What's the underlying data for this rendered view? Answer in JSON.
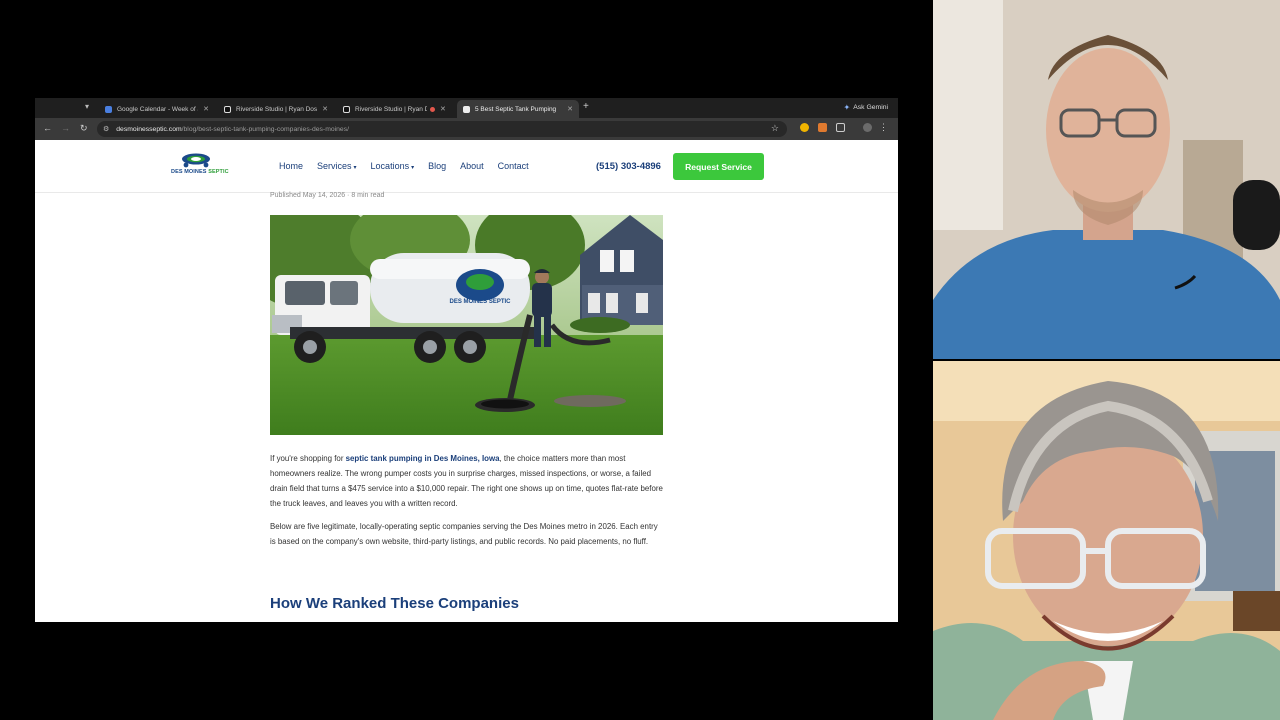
{
  "browser": {
    "tabs": [
      {
        "title": "Google Calendar - Week of J",
        "favicon_color": "#4a7fe0",
        "active": false
      },
      {
        "title": "Riverside Studio | Ryan Dosw",
        "favicon_color": "#dddddd",
        "active": false
      },
      {
        "title": "Riverside Studio | Ryan D",
        "favicon_color": "#dddddd",
        "active": false,
        "recording": true
      },
      {
        "title": "5 Best Septic Tank Pumping",
        "favicon_color": "#dddddd",
        "active": true
      }
    ],
    "new_tab_symbol": "+",
    "gemini_label": "Ask Gemini",
    "address": {
      "domain": "desmoinesseptic.com",
      "path": "/blog/best-septic-tank-pumping-companies-des-moines/"
    }
  },
  "site": {
    "logo": {
      "text_primary": "DES MOINES",
      "text_accent": "SEPTIC"
    },
    "nav": [
      {
        "label": "Home",
        "has_dropdown": false
      },
      {
        "label": "Services",
        "has_dropdown": true
      },
      {
        "label": "Locations",
        "has_dropdown": true
      },
      {
        "label": "Blog",
        "has_dropdown": false
      },
      {
        "label": "About",
        "has_dropdown": false
      },
      {
        "label": "Contact",
        "has_dropdown": false
      }
    ],
    "phone": "(515) 303-4896",
    "cta_label": "Request Service",
    "colors": {
      "brand_blue": "#1b3f7a",
      "cta_green": "#3cc83c"
    }
  },
  "article": {
    "published": "Published May 14, 2026 · 8 min read",
    "hero_truck_label": "DES MOINES SEPTIC",
    "para1_before": "If you're shopping for ",
    "para1_link": "septic tank pumping in Des Moines, Iowa",
    "para1_after": ", the choice matters more than most homeowners realize. The wrong pumper costs you in surprise charges, missed inspections, or worse, a failed drain field that turns a $475 service into a $10,000 repair. The right one shows up on time, quotes flat-rate before the truck leaves, and leaves you with a written record.",
    "para2": "Below are five legitimate, locally-operating septic companies serving the Des Moines metro in 2026. Each entry is based on the company's own website, third-party listings, and public records. No paid placements, no fluff.",
    "section_heading": "How We Ranked These Companies"
  }
}
